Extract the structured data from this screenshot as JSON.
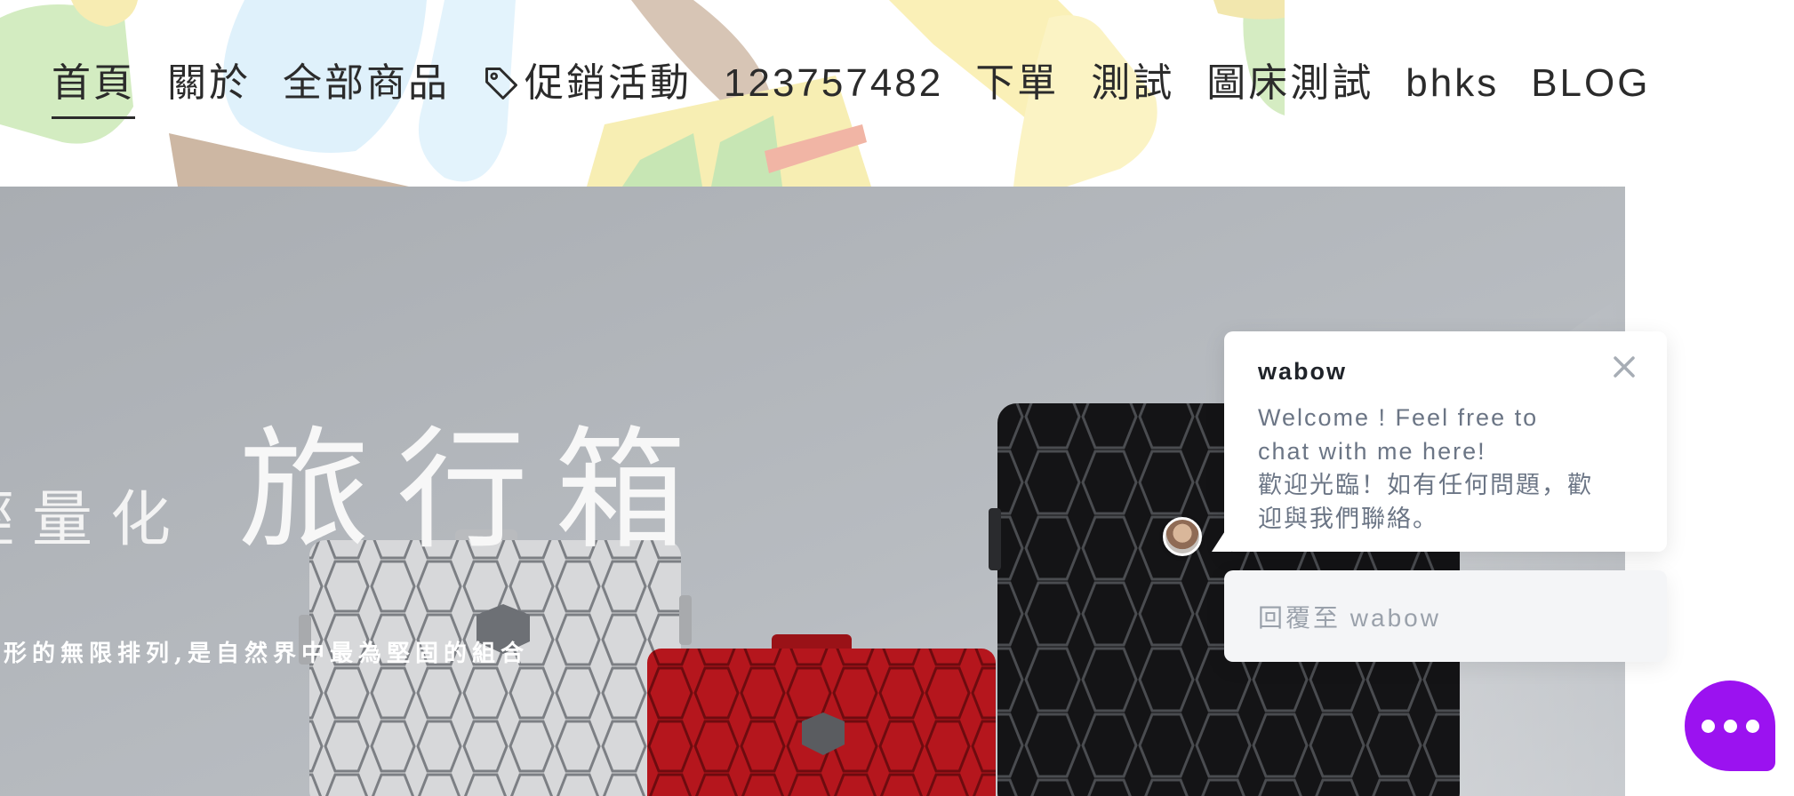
{
  "nav": {
    "items": [
      {
        "label": "首頁",
        "active": true
      },
      {
        "label": "關於"
      },
      {
        "label": "全部商品"
      },
      {
        "label": "促銷活動",
        "icon": "tag-icon"
      },
      {
        "label": "123757482"
      },
      {
        "label": "下單"
      },
      {
        "label": "測試"
      },
      {
        "label": "圖床測試"
      },
      {
        "label": "bhks"
      },
      {
        "label": "BLOG"
      }
    ]
  },
  "hero": {
    "prefix": "輕量化",
    "title": "旅行箱",
    "subtitle": "邊形的無限排列,是自然界中最為堅固的組合"
  },
  "chat": {
    "name": "wabow",
    "message": "Welcome ! Feel free to\nchat with me here!\n歡迎光臨！如有任何問題，歡\n迎與我們聯絡。",
    "reply_placeholder": "回覆至 wabow",
    "launcher_icon": "chat-bubble-dots-icon",
    "close_icon": "close-icon",
    "accent_color": "#9b12f0"
  }
}
